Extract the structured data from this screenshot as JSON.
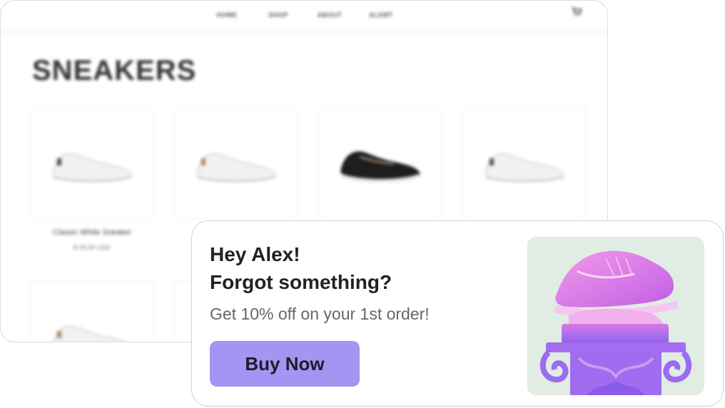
{
  "store": {
    "nav": [
      "HOME",
      "SHOP",
      "ABOUT",
      "ALEMT"
    ],
    "cart_icon": "cart-icon",
    "title": "SNEAKERS",
    "products": [
      {
        "name": "Classic White Sneaker",
        "price": "$ 00.00 USD",
        "shoe": "white"
      },
      {
        "name": "",
        "price": "",
        "shoe": "white"
      },
      {
        "name": "",
        "price": "",
        "shoe": "black"
      },
      {
        "name": "",
        "price": "",
        "shoe": "white"
      },
      {
        "name": "",
        "price": "",
        "shoe": "white"
      },
      {
        "name": "",
        "price": "",
        "shoe": "white"
      }
    ]
  },
  "popup": {
    "greeting": "Hey Alex!",
    "question": "Forgot something?",
    "offer": "Get 10% off on your 1st order!",
    "button_label": "Buy Now",
    "image": "pink-sneaker-on-pedestal",
    "colors": {
      "button": "#a694f2",
      "image_background": "#e1ece5",
      "sneaker": "#e77bf0",
      "pedestal": "#9b6cf0"
    }
  }
}
